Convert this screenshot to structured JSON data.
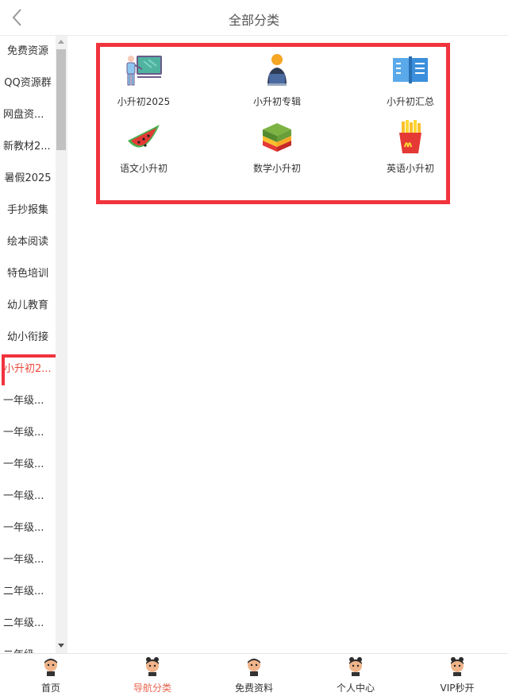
{
  "header": {
    "title": "全部分类"
  },
  "sidebar": {
    "items": [
      {
        "label": "免费资源",
        "state": "normal"
      },
      {
        "label": "QQ资源群",
        "state": "normal"
      },
      {
        "label": "网盘资...",
        "state": "normal"
      },
      {
        "label": "新教材2...",
        "state": "normal"
      },
      {
        "label": "暑假2025",
        "state": "normal"
      },
      {
        "label": "手抄报集",
        "state": "normal"
      },
      {
        "label": "绘本阅读",
        "state": "normal"
      },
      {
        "label": "特色培训",
        "state": "normal"
      },
      {
        "label": "幼儿教育",
        "state": "normal"
      },
      {
        "label": "幼小衔接",
        "state": "normal"
      },
      {
        "label": "小升初2...",
        "state": "active"
      },
      {
        "label": "一年级...",
        "state": "normal"
      },
      {
        "label": "一年级...",
        "state": "normal"
      },
      {
        "label": "一年级...",
        "state": "normal"
      },
      {
        "label": "一年级...",
        "state": "normal"
      },
      {
        "label": "一年级...",
        "state": "normal"
      },
      {
        "label": "一年级...",
        "state": "normal"
      },
      {
        "label": "二年级...",
        "state": "normal"
      },
      {
        "label": "二年级...",
        "state": "normal"
      },
      {
        "label": "二年级...",
        "state": "normal"
      }
    ]
  },
  "categories": [
    {
      "label": "小升初2025",
      "icon": "teacher-board-icon"
    },
    {
      "label": "小升初专辑",
      "icon": "student-laptop-icon"
    },
    {
      "label": "小升初汇总",
      "icon": "open-book-icon"
    },
    {
      "label": "语文小升初",
      "icon": "watermelon-icon"
    },
    {
      "label": "数学小升初",
      "icon": "layer-cake-icon"
    },
    {
      "label": "英语小升初",
      "icon": "fries-icon"
    }
  ],
  "tabbar": {
    "tabs": [
      {
        "label": "首页",
        "active": false
      },
      {
        "label": "导航分类",
        "active": true
      },
      {
        "label": "免费资料",
        "active": false
      },
      {
        "label": "个人中心",
        "active": false
      },
      {
        "label": "VIP秒开",
        "active": false
      }
    ]
  },
  "colors": {
    "highlight_border": "#f1333d",
    "active_text": "#e84a3c",
    "active_tab": "#e8624d"
  }
}
